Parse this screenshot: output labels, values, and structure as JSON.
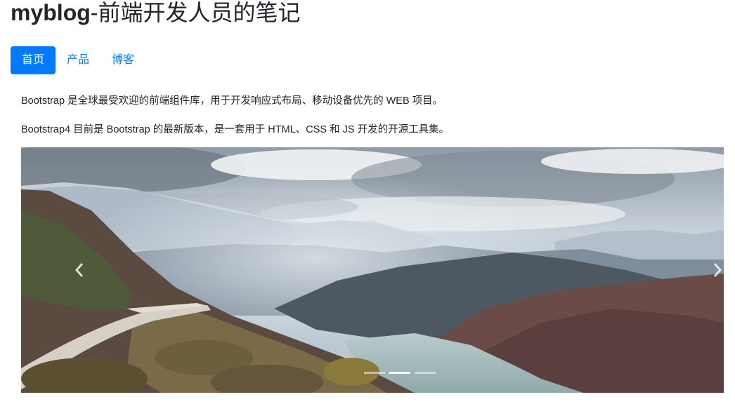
{
  "header": {
    "brand": "myblog",
    "title_rest": "-前端开发人员的笔记"
  },
  "nav": {
    "items": [
      {
        "label": "首页",
        "active": true
      },
      {
        "label": "产品",
        "active": false
      },
      {
        "label": "博客",
        "active": false
      }
    ]
  },
  "content": {
    "paragraph1": "Bootstrap 是全球最受欢迎的前端组件库，用于开发响应式布局、移动设备优先的 WEB 项目。",
    "paragraph2": "Bootstrap4 目前是 Bootstrap 的最新版本，是一套用于 HTML、CSS 和 JS 开发的开源工具集。"
  },
  "carousel": {
    "slide_count": 3,
    "active_index": 1,
    "prev_icon": "chevron-left-icon",
    "next_icon": "chevron-right-icon"
  },
  "colors": {
    "primary": "#007bff",
    "text": "#212529"
  }
}
